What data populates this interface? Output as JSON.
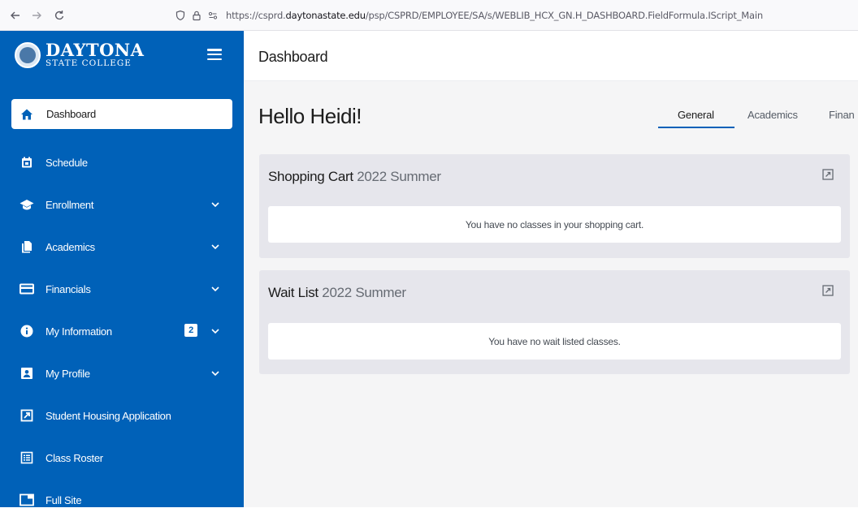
{
  "browser": {
    "url_prefix": "https://csprd.",
    "url_domain": "daytonastate.edu",
    "url_path": "/psp/CSPRD/EMPLOYEE/SA/s/WEBLIB_HCX_GN.H_DASHBOARD.FieldFormula.IScript_Main"
  },
  "logo": {
    "line1": "DAYTONA",
    "line2": "STATE COLLEGE"
  },
  "sidebar": {
    "items": [
      {
        "label": "Dashboard",
        "icon": "home-icon",
        "active": true
      },
      {
        "label": "Schedule",
        "icon": "calendar-icon"
      },
      {
        "label": "Enrollment",
        "icon": "graduation-cap-icon",
        "chevron": true
      },
      {
        "label": "Academics",
        "icon": "documents-icon",
        "chevron": true
      },
      {
        "label": "Financials",
        "icon": "credit-card-icon",
        "chevron": true
      },
      {
        "label": "My Information",
        "icon": "info-icon",
        "chevron": true,
        "badge": "2"
      },
      {
        "label": "My Profile",
        "icon": "profile-card-icon",
        "chevron": true
      },
      {
        "label": "Student Housing Application",
        "icon": "external-link-icon"
      },
      {
        "label": "Class Roster",
        "icon": "list-icon"
      },
      {
        "label": "Full Site",
        "icon": "window-icon"
      }
    ]
  },
  "header": {
    "title": "Dashboard"
  },
  "main": {
    "greeting": "Hello Heidi!",
    "tabs": [
      "General",
      "Academics",
      "Finan"
    ]
  },
  "cards": [
    {
      "title": "Shopping Cart",
      "term": "2022 Summer",
      "message": "You have no classes in your shopping cart."
    },
    {
      "title": "Wait List",
      "term": "2022 Summer",
      "message": "You have no wait listed classes."
    }
  ],
  "colors": {
    "sidebar": "#0061b8",
    "accent": "#0061b8",
    "card_bg": "#e6e6ec"
  }
}
